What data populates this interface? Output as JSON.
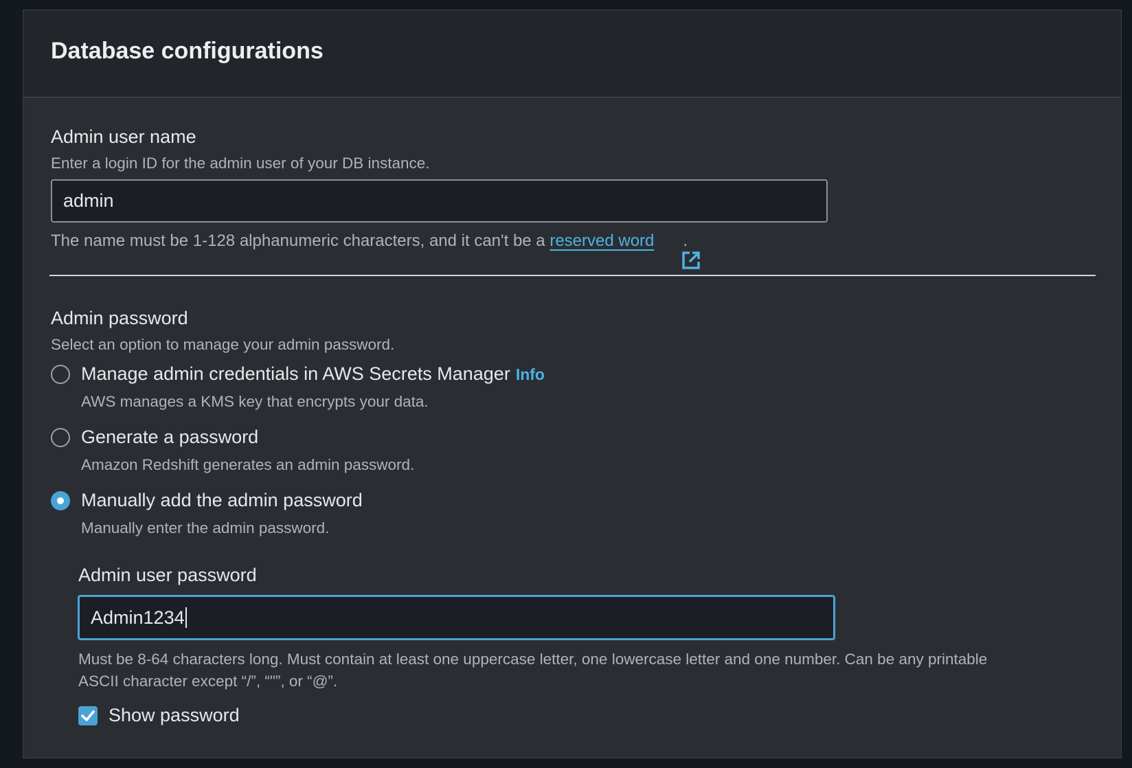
{
  "section": {
    "title": "Database configurations"
  },
  "admin_user": {
    "label": "Admin user name",
    "description": "Enter a login ID for the admin user of your DB instance.",
    "value": "admin",
    "help_prefix": "The name must be 1-128 alphanumeric characters, and it can't be a ",
    "help_link": "reserved word",
    "help_suffix": "."
  },
  "admin_password": {
    "label": "Admin password",
    "description": "Select an option to manage your admin password.",
    "options": [
      {
        "label": "Manage admin credentials in AWS Secrets Manager",
        "info": "Info",
        "description": "AWS manages a KMS key that encrypts your data.",
        "selected": false
      },
      {
        "label": "Generate a password",
        "description": "Amazon Redshift generates an admin password.",
        "selected": false
      },
      {
        "label": "Manually add the admin password",
        "description": "Manually enter the admin password.",
        "selected": true
      }
    ]
  },
  "password_field": {
    "label": "Admin user password",
    "value": "Admin1234",
    "help_line1": "Must be 8-64 characters long. Must contain at least one uppercase letter, one lowercase letter and one number. Can be any printable",
    "help_line2": "ASCII character except “/”, “\"”, or “@”."
  },
  "show_password": {
    "label": "Show password",
    "checked": true
  },
  "colors": {
    "accent": "#4aa3d6",
    "link": "#4fb1e3",
    "panel_bg": "#2a2e33",
    "page_bg": "#14181f"
  },
  "icons": [
    "external-link-icon",
    "checkmark-icon"
  ]
}
